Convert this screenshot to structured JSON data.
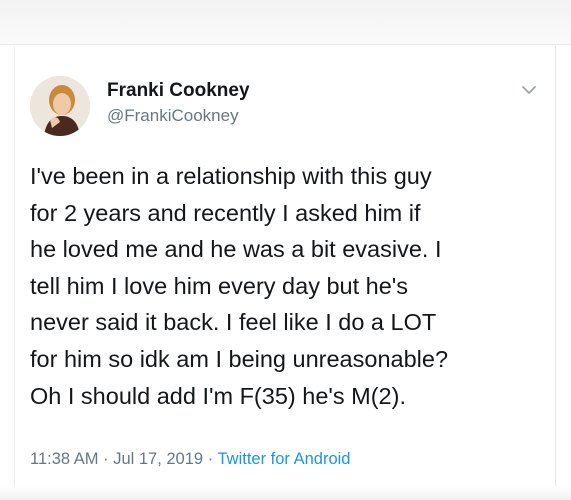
{
  "tweet": {
    "author_name": "Franki Cookney",
    "author_handle": "@FrankiCookney",
    "text_lines": [
      "I've been in a relationship with this guy",
      "for 2 years and recently I asked him if",
      "he loved me and he was a bit evasive. I",
      "tell him I love him every day but he's",
      "never said it back. I feel like I do a LOT",
      "for him so idk am I being unreasonable?",
      "Oh I should add I'm F(35) he's M(2)."
    ],
    "time": "11:38 AM",
    "separator": "·",
    "date": "Jul 17, 2019",
    "source": "Twitter for Android"
  },
  "colors": {
    "text": "#14171a",
    "secondary": "#657786",
    "link": "#1b95e0"
  },
  "icons": {
    "avatar": "profile-photo",
    "menu": "chevron-down-icon"
  }
}
